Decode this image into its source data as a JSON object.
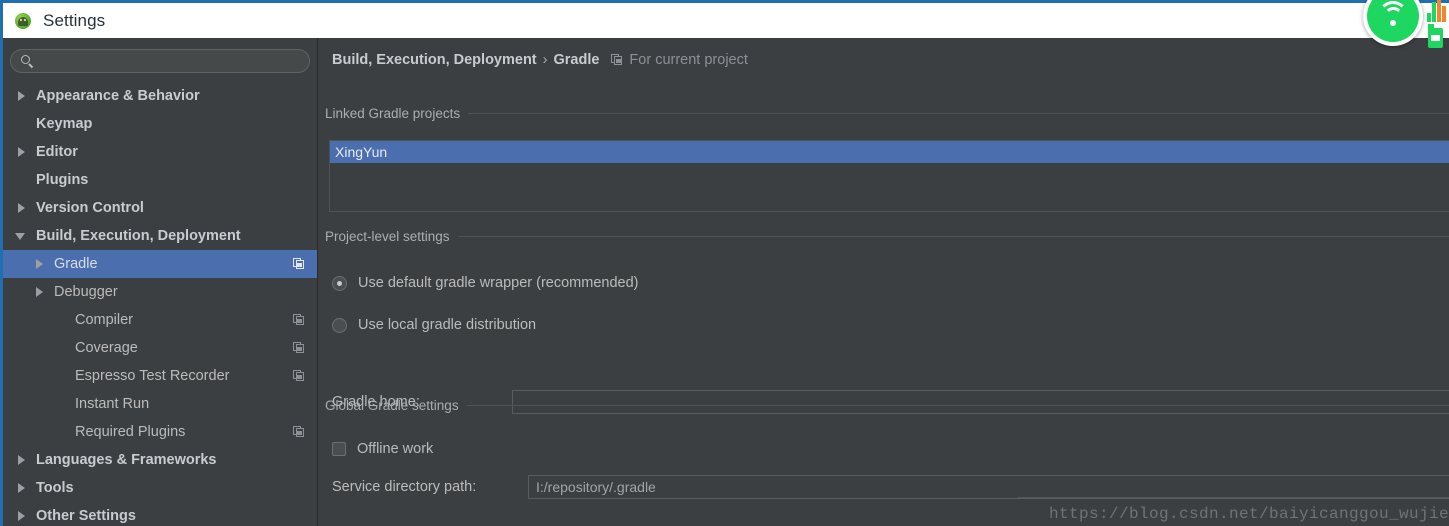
{
  "window": {
    "title": "Settings",
    "app_icon": "android-studio-icon",
    "accent_selection": "#4b6eaf",
    "background": "#3c3f41",
    "titlebar_background": "#ffffff"
  },
  "search": {
    "placeholder": "",
    "value": "",
    "icon": "search-icon"
  },
  "sidebar": {
    "items": [
      {
        "label": "Appearance & Behavior",
        "arrow": "right",
        "indent": 0,
        "bold": true,
        "selected": false,
        "project_icon": false
      },
      {
        "label": "Keymap",
        "arrow": "none",
        "indent": 0,
        "bold": true,
        "selected": false,
        "project_icon": false
      },
      {
        "label": "Editor",
        "arrow": "right",
        "indent": 0,
        "bold": true,
        "selected": false,
        "project_icon": false
      },
      {
        "label": "Plugins",
        "arrow": "none",
        "indent": 0,
        "bold": true,
        "selected": false,
        "project_icon": false
      },
      {
        "label": "Version Control",
        "arrow": "right",
        "indent": 0,
        "bold": true,
        "selected": false,
        "project_icon": false
      },
      {
        "label": "Build, Execution, Deployment",
        "arrow": "down",
        "indent": 0,
        "bold": true,
        "selected": false,
        "project_icon": false
      },
      {
        "label": "Gradle",
        "arrow": "right",
        "indent": 1,
        "bold": false,
        "selected": true,
        "project_icon": true
      },
      {
        "label": "Debugger",
        "arrow": "right",
        "indent": 1,
        "bold": false,
        "selected": false,
        "project_icon": false
      },
      {
        "label": "Compiler",
        "arrow": "none",
        "indent": 2,
        "bold": false,
        "selected": false,
        "project_icon": true
      },
      {
        "label": "Coverage",
        "arrow": "none",
        "indent": 2,
        "bold": false,
        "selected": false,
        "project_icon": true
      },
      {
        "label": "Espresso Test Recorder",
        "arrow": "none",
        "indent": 2,
        "bold": false,
        "selected": false,
        "project_icon": true
      },
      {
        "label": "Instant Run",
        "arrow": "none",
        "indent": 2,
        "bold": false,
        "selected": false,
        "project_icon": false
      },
      {
        "label": "Required Plugins",
        "arrow": "none",
        "indent": 2,
        "bold": false,
        "selected": false,
        "project_icon": true
      },
      {
        "label": "Languages & Frameworks",
        "arrow": "right",
        "indent": 0,
        "bold": true,
        "selected": false,
        "project_icon": false
      },
      {
        "label": "Tools",
        "arrow": "right",
        "indent": 0,
        "bold": true,
        "selected": false,
        "project_icon": false
      },
      {
        "label": "Other Settings",
        "arrow": "right",
        "indent": 0,
        "bold": true,
        "selected": false,
        "project_icon": false
      }
    ]
  },
  "breadcrumb": {
    "parent": "Build, Execution, Deployment",
    "separator": "›",
    "current": "Gradle",
    "scope_icon": "project-scope-icon",
    "scope": "For current project"
  },
  "linked_projects": {
    "section_title": "Linked Gradle projects",
    "items": [
      {
        "label": "XingYun",
        "selected": true
      }
    ]
  },
  "project_level": {
    "section_title": "Project-level settings",
    "radios": [
      {
        "label": "Use default gradle wrapper (recommended)",
        "checked": true
      },
      {
        "label": "Use local gradle distribution",
        "checked": false
      }
    ],
    "gradle_home": {
      "label": "Gradle home:",
      "value": "",
      "placeholder": ""
    }
  },
  "global_settings": {
    "section_title": "Global Gradle settings",
    "offline_work": {
      "label": "Offline work",
      "checked": false
    },
    "service_directory": {
      "label": "Service directory path:",
      "value": "I:/repository/.gradle"
    }
  },
  "overlays": {
    "wifi_badge_icon": "wifi-icon",
    "tray_signal_icon": "signal-bars-icon",
    "tray_battery_icon": "battery-icon",
    "watermark": "https://blog.csdn.net/baiyicanggou_wujie"
  }
}
